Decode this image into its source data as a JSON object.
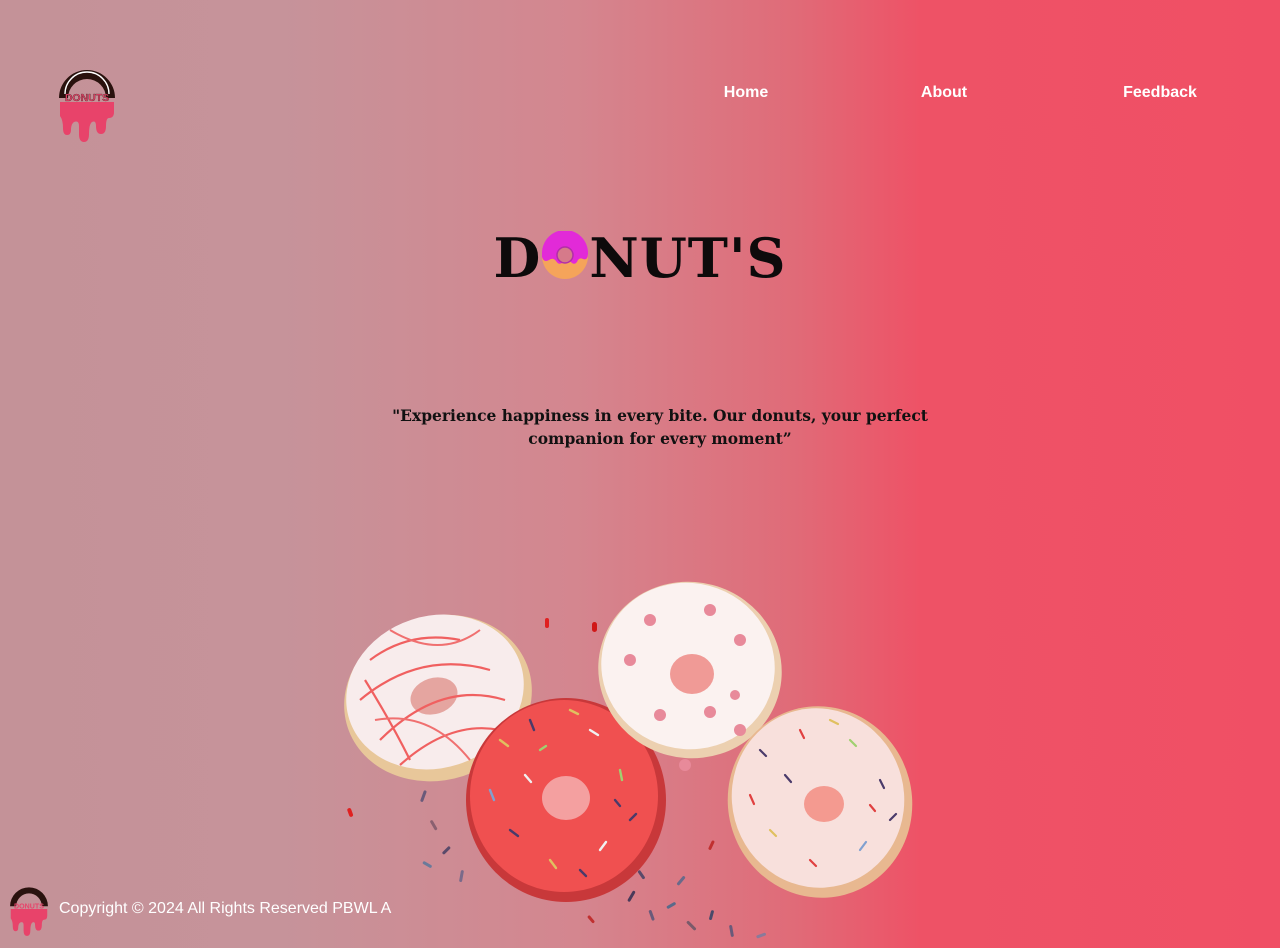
{
  "brand": {
    "logo_text": "DONUTS",
    "colors": {
      "pink": "#e8436a",
      "dark": "#2a120e",
      "background_left": "#c49298",
      "background_right": "#f04f65"
    }
  },
  "nav": {
    "items": [
      {
        "label": "Home"
      },
      {
        "label": "About"
      },
      {
        "label": "Feedback"
      }
    ]
  },
  "hero": {
    "title_before": "D",
    "title_icon": "donut-icon",
    "title_after": "NUT'S",
    "tagline": "\"Experience happiness in every bite. Our donuts, your perfect companion for every moment”"
  },
  "footer": {
    "copyright": "Copyright © 2024 All Rights Reserved PBWL A"
  }
}
